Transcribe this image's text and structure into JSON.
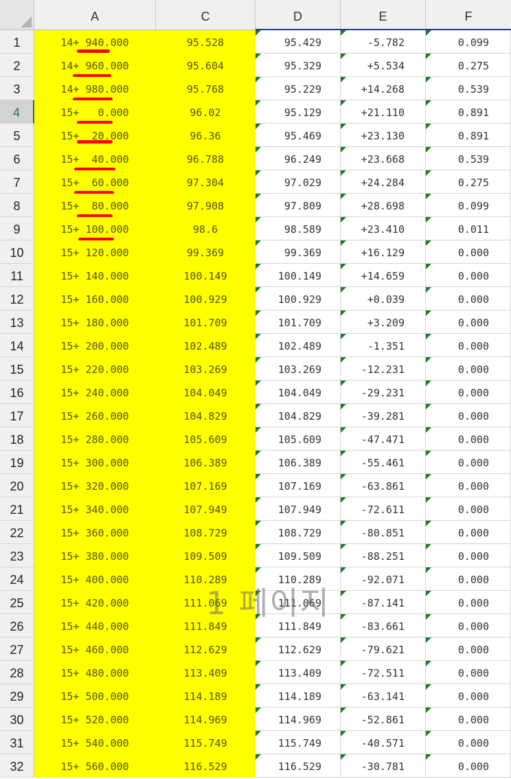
{
  "columns": [
    "A",
    "C",
    "D",
    "E",
    "F"
  ],
  "watermark": "1 페이지",
  "colors": {
    "highlight": "#ffff00",
    "underline_mark": "#ff0000",
    "indicator_triangle": "#1e7b1e",
    "active_row_text": "#217346"
  },
  "active_row": 4,
  "rows": [
    {
      "num": "1",
      "a": "14+ 940.000",
      "c": "95.528",
      "d": "95.429",
      "e": "-5.782",
      "f": "0.099"
    },
    {
      "num": "2",
      "a": "14+ 960.000",
      "c": "95.604",
      "d": "95.329",
      "e": "+5.534",
      "f": "0.275"
    },
    {
      "num": "3",
      "a": "14+ 980.000",
      "c": "95.768",
      "d": "95.229",
      "e": "+14.268",
      "f": "0.539"
    },
    {
      "num": "4",
      "a": "15+   0.000",
      "c": "96.02",
      "d": "95.129",
      "e": "+21.110",
      "f": "0.891"
    },
    {
      "num": "5",
      "a": "15+  20.000",
      "c": "96.36",
      "d": "95.469",
      "e": "+23.130",
      "f": "0.891"
    },
    {
      "num": "6",
      "a": "15+  40.000",
      "c": "96.788",
      "d": "96.249",
      "e": "+23.668",
      "f": "0.539"
    },
    {
      "num": "7",
      "a": "15+  60.000",
      "c": "97.304",
      "d": "97.029",
      "e": "+24.284",
      "f": "0.275"
    },
    {
      "num": "8",
      "a": "15+  80.000",
      "c": "97.908",
      "d": "97.809",
      "e": "+28.698",
      "f": "0.099"
    },
    {
      "num": "9",
      "a": "15+ 100.000",
      "c": "98.6",
      "d": "98.589",
      "e": "+23.410",
      "f": "0.011"
    },
    {
      "num": "10",
      "a": "15+ 120.000",
      "c": "99.369",
      "d": "99.369",
      "e": "+16.129",
      "f": "0.000"
    },
    {
      "num": "11",
      "a": "15+ 140.000",
      "c": "100.149",
      "d": "100.149",
      "e": "+14.659",
      "f": "0.000"
    },
    {
      "num": "12",
      "a": "15+ 160.000",
      "c": "100.929",
      "d": "100.929",
      "e": "+0.039",
      "f": "0.000"
    },
    {
      "num": "13",
      "a": "15+ 180.000",
      "c": "101.709",
      "d": "101.709",
      "e": "+3.209",
      "f": "0.000"
    },
    {
      "num": "14",
      "a": "15+ 200.000",
      "c": "102.489",
      "d": "102.489",
      "e": "-1.351",
      "f": "0.000"
    },
    {
      "num": "15",
      "a": "15+ 220.000",
      "c": "103.269",
      "d": "103.269",
      "e": "-12.231",
      "f": "0.000"
    },
    {
      "num": "16",
      "a": "15+ 240.000",
      "c": "104.049",
      "d": "104.049",
      "e": "-29.231",
      "f": "0.000"
    },
    {
      "num": "17",
      "a": "15+ 260.000",
      "c": "104.829",
      "d": "104.829",
      "e": "-39.281",
      "f": "0.000"
    },
    {
      "num": "18",
      "a": "15+ 280.000",
      "c": "105.609",
      "d": "105.609",
      "e": "-47.471",
      "f": "0.000"
    },
    {
      "num": "19",
      "a": "15+ 300.000",
      "c": "106.389",
      "d": "106.389",
      "e": "-55.461",
      "f": "0.000"
    },
    {
      "num": "20",
      "a": "15+ 320.000",
      "c": "107.169",
      "d": "107.169",
      "e": "-63.861",
      "f": "0.000"
    },
    {
      "num": "21",
      "a": "15+ 340.000",
      "c": "107.949",
      "d": "107.949",
      "e": "-72.611",
      "f": "0.000"
    },
    {
      "num": "22",
      "a": "15+ 360.000",
      "c": "108.729",
      "d": "108.729",
      "e": "-80.851",
      "f": "0.000"
    },
    {
      "num": "23",
      "a": "15+ 380.000",
      "c": "109.509",
      "d": "109.509",
      "e": "-88.251",
      "f": "0.000"
    },
    {
      "num": "24",
      "a": "15+ 400.000",
      "c": "110.289",
      "d": "110.289",
      "e": "-92.071",
      "f": "0.000"
    },
    {
      "num": "25",
      "a": "15+ 420.000",
      "c": "111.069",
      "d": "111.069",
      "e": "-87.141",
      "f": "0.000"
    },
    {
      "num": "26",
      "a": "15+ 440.000",
      "c": "111.849",
      "d": "111.849",
      "e": "-83.661",
      "f": "0.000"
    },
    {
      "num": "27",
      "a": "15+ 460.000",
      "c": "112.629",
      "d": "112.629",
      "e": "-79.621",
      "f": "0.000"
    },
    {
      "num": "28",
      "a": "15+ 480.000",
      "c": "113.409",
      "d": "113.409",
      "e": "-72.511",
      "f": "0.000"
    },
    {
      "num": "29",
      "a": "15+ 500.000",
      "c": "114.189",
      "d": "114.189",
      "e": "-63.141",
      "f": "0.000"
    },
    {
      "num": "30",
      "a": "15+ 520.000",
      "c": "114.969",
      "d": "114.969",
      "e": "-52.861",
      "f": "0.000"
    },
    {
      "num": "31",
      "a": "15+ 540.000",
      "c": "115.749",
      "d": "115.749",
      "e": "-40.571",
      "f": "0.000"
    },
    {
      "num": "32",
      "a": "15+ 560.000",
      "c": "116.529",
      "d": "116.529",
      "e": "-30.781",
      "f": "0.000"
    }
  ]
}
